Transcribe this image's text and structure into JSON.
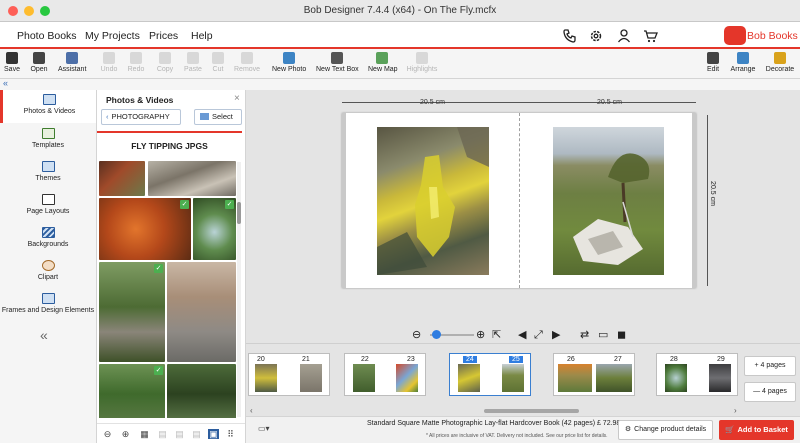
{
  "window": {
    "title": "Bob Designer 7.4.4 (x64) - On The Fly.mcfx"
  },
  "menu": {
    "items": [
      "Photo Books",
      "My Projects",
      "Prices",
      "Help"
    ]
  },
  "brand": {
    "name": "Bob Books",
    "color": "#e4362a"
  },
  "top_icons": [
    "phone-icon",
    "settings-icon",
    "account-icon",
    "cart-icon"
  ],
  "toolbar": {
    "save": "Save",
    "open": "Open",
    "assistant": "Assistant",
    "undo": "Undo",
    "redo": "Redo",
    "copy": "Copy",
    "paste": "Paste",
    "cut": "Cut",
    "remove": "Remove",
    "new_photo": "New Photo",
    "new_text_box": "New Text Box",
    "new_map": "New Map",
    "highlights": "Highlights",
    "edit": "Edit",
    "arrange": "Arrange",
    "decorate": "Decorate"
  },
  "sidebar": {
    "items": [
      "Photos & Videos",
      "Templates",
      "Themes",
      "Page Layouts",
      "Backgrounds",
      "Clipart",
      "Frames and Design Elements"
    ],
    "collapse": "«",
    "top_collapse": "«"
  },
  "panel": {
    "title": "Photos & Videos",
    "close": "×",
    "back_label": "PHOTOGRAPHY",
    "select_label": "Select",
    "album_title": "FLY TIPPING JPGS"
  },
  "workspace": {
    "left_width": "20.5 cm",
    "right_width": "20.5 cm",
    "height": "20.5 cm"
  },
  "pages": {
    "spreads": [
      {
        "left": "20",
        "right": "21"
      },
      {
        "left": "22",
        "right": "23"
      },
      {
        "left": "24",
        "right": "25"
      },
      {
        "left": "26",
        "right": "27"
      },
      {
        "left": "28",
        "right": "29"
      }
    ],
    "add_pages": "+ 4 pages",
    "remove_pages": "— 4 pages"
  },
  "footer": {
    "product": "Standard Square Matte Photographic Lay-flat Hardcover Book (42 pages) £ 72.98*",
    "note": "* All prices are inclusive of VAT. Delivery not included. See our price list for details.",
    "change_label": "Change product details",
    "basket_label": "Add to Basket"
  },
  "colors": {
    "accent": "#e4362a",
    "selection": "#2f7de1"
  }
}
